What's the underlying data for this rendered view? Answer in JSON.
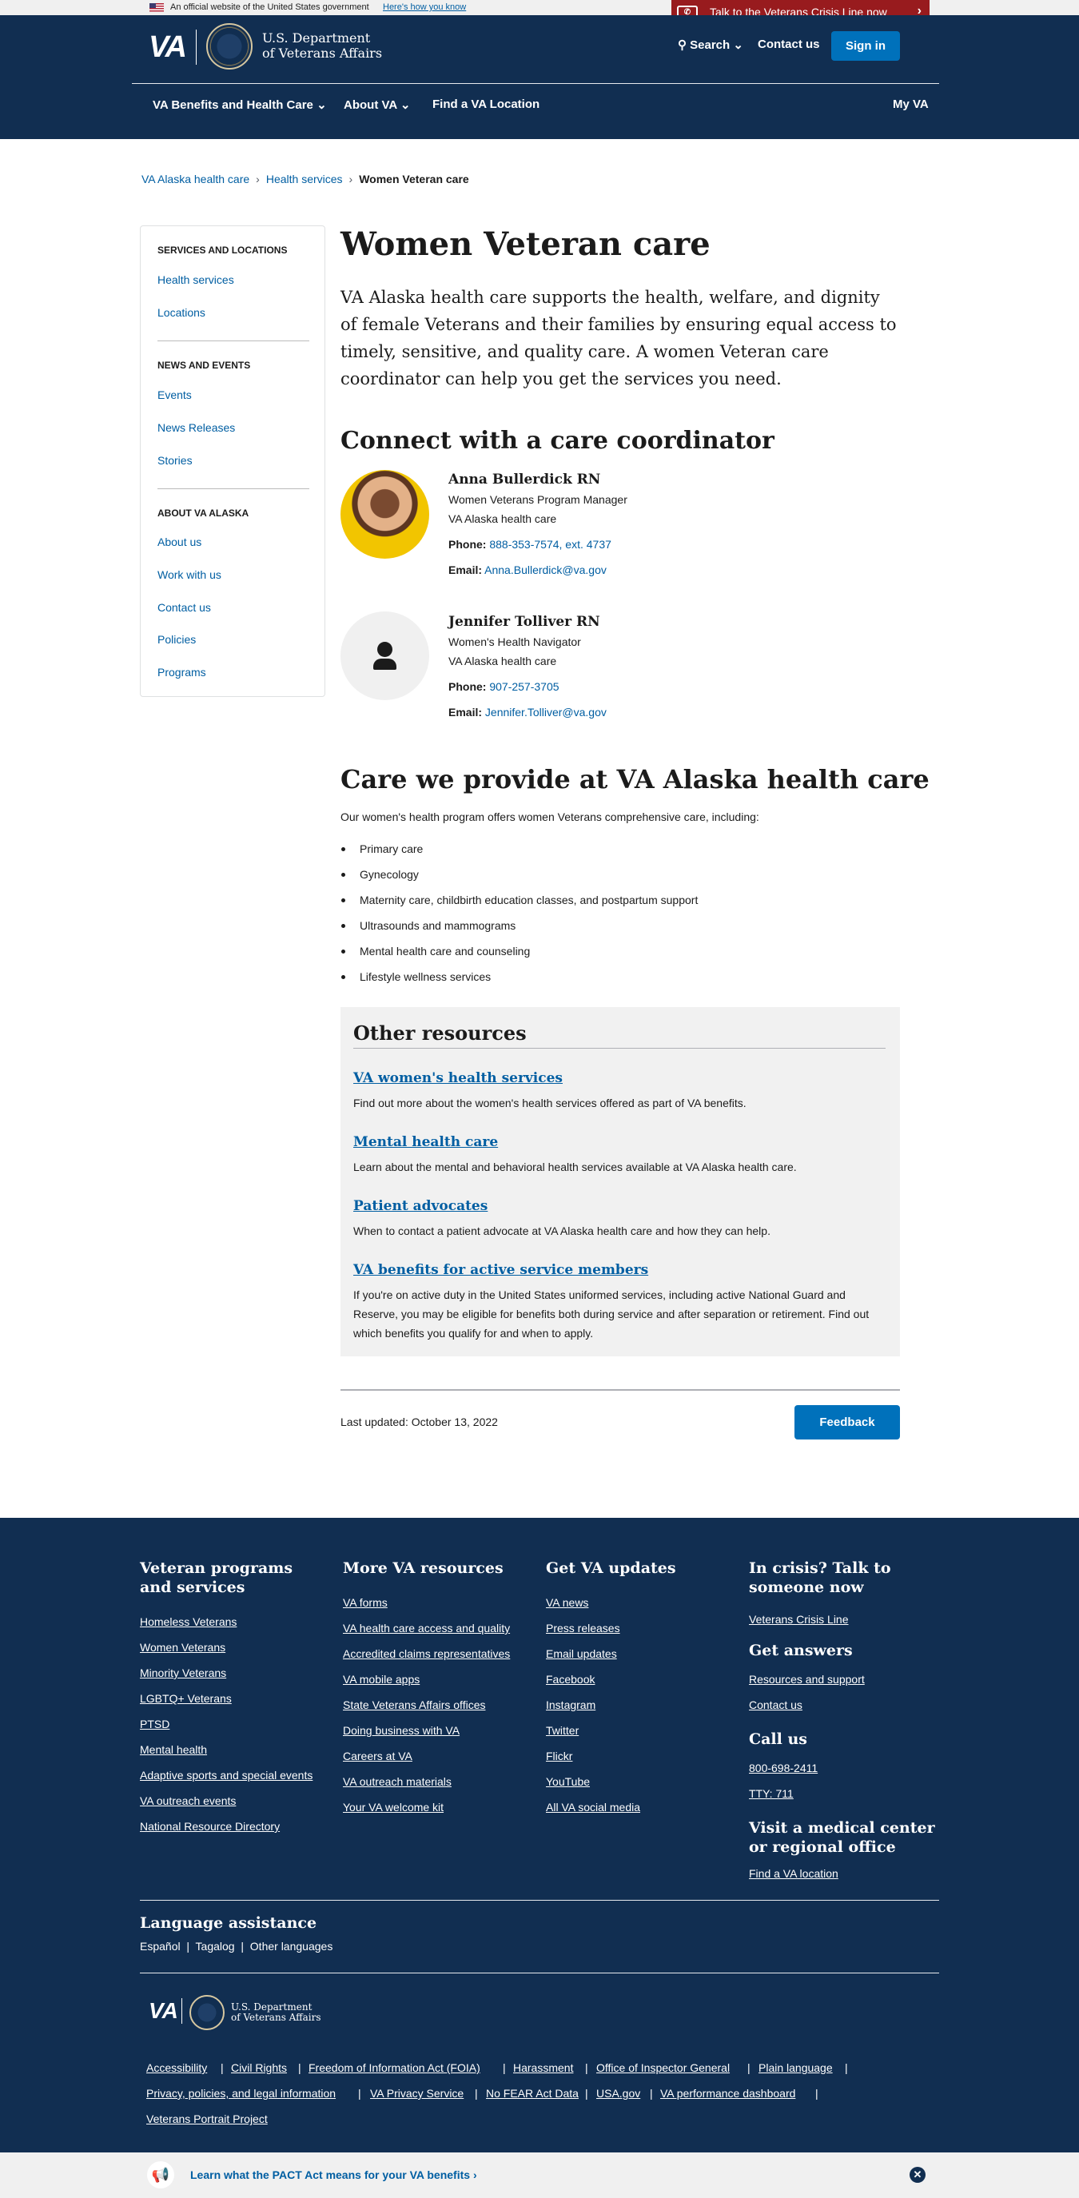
{
  "gov_banner": {
    "text": "An official website of the United States government",
    "how": "Here's how you know"
  },
  "crisis": {
    "text": "Talk to the Veterans Crisis Line now"
  },
  "header": {
    "logo": "VA",
    "dept_line1": "U.S. Department",
    "dept_line2": "of Veterans Affairs",
    "search": "Search",
    "contact": "Contact us",
    "signin": "Sign in",
    "nav": [
      "VA Benefits and Health Care",
      "About VA",
      "Find a VA Location",
      "My VA"
    ]
  },
  "breadcrumb": [
    "VA Alaska health care",
    "Health services",
    "Women Veteran care"
  ],
  "sidebar": {
    "sections": [
      {
        "heading": "SERVICES AND LOCATIONS",
        "links": [
          "Health services",
          "Locations"
        ]
      },
      {
        "heading": "NEWS AND EVENTS",
        "links": [
          "Events",
          "News Releases",
          "Stories"
        ]
      },
      {
        "heading": "ABOUT VA ALASKA",
        "links": [
          "About us",
          "Work with us",
          "Contact us",
          "Policies",
          "Programs"
        ]
      }
    ]
  },
  "main": {
    "title": "Women Veteran care",
    "intro": "VA Alaska health care supports the health, welfare, and dignity of female Veterans and their families by ensuring equal access to timely, sensitive, and quality care. A women Veteran care coordinator can help you get the services you need.",
    "connect_heading": "Connect with a care coordinator",
    "phone_label": "Phone:",
    "email_label": "Email:",
    "people": [
      {
        "name": "Anna Bullerdick RN",
        "role": "Women Veterans Program Manager",
        "org": "VA Alaska health care",
        "phone": "888-353-7574, ext. 4737",
        "email": "Anna.Bullerdick@va.gov"
      },
      {
        "name": "Jennifer Tolliver RN",
        "role": "Women's Health Navigator",
        "org": "VA Alaska health care",
        "phone": "907-257-3705",
        "email": "Jennifer.Tolliver@va.gov"
      }
    ],
    "care_heading": "Care we provide at VA Alaska health care",
    "care_intro": "Our women's health program offers women Veterans comprehensive care, including:",
    "care_list": [
      "Primary care",
      "Gynecology",
      "Maternity care, childbirth education classes, and postpartum support",
      "Ultrasounds and mammograms",
      "Mental health care and counseling",
      "Lifestyle wellness services"
    ],
    "resources": {
      "heading": "Other resources",
      "items": [
        {
          "link": "VA women's health services",
          "desc": "Find out more about the women's health services offered as part of VA benefits."
        },
        {
          "link": "Mental health care",
          "desc": "Learn about the mental and behavioral health services available at VA Alaska health care."
        },
        {
          "link": "Patient advocates",
          "desc": "When to contact a patient advocate at VA Alaska health care and how they can help."
        },
        {
          "link": "VA benefits for active service members",
          "desc": "If you're on active duty in the United States uniformed services, including active National Guard and Reserve, you may be eligible for benefits both during service and after separation or retirement. Find out which benefits you qualify for and when to apply."
        }
      ]
    },
    "last_updated": "Last updated: October 13, 2022",
    "feedback": "Feedback"
  },
  "footer": {
    "col1": {
      "heading": "Veteran programs and services",
      "links": [
        "Homeless Veterans",
        "Women Veterans",
        "Minority Veterans",
        "LGBTQ+ Veterans",
        "PTSD",
        "Mental health",
        "Adaptive sports and special events",
        "VA outreach events",
        "National Resource Directory"
      ]
    },
    "col2": {
      "heading": "More VA resources",
      "links": [
        "VA forms",
        "VA health care access and quality",
        "Accredited claims representatives",
        "VA mobile apps",
        "State Veterans Affairs offices",
        "Doing business with VA",
        "Careers at VA",
        "VA outreach materials",
        "Your VA welcome kit"
      ]
    },
    "col3": {
      "heading": "Get VA updates",
      "links": [
        "VA news",
        "Press releases",
        "Email updates",
        "Facebook",
        "Instagram",
        "Twitter",
        "Flickr",
        "YouTube",
        "All VA social media"
      ]
    },
    "col4": {
      "crisis_heading": "In crisis? Talk to someone now",
      "crisis_link": "Veterans Crisis Line",
      "answers_heading": "Get answers",
      "answers_links": [
        "Resources and support",
        "Contact us"
      ],
      "call_heading": "Call us",
      "call_links": [
        "800-698-2411",
        "TTY: 711"
      ],
      "visit_heading": "Visit a medical center or regional office",
      "visit_link": "Find a VA location"
    },
    "language": {
      "heading": "Language assistance",
      "links": [
        "Español",
        "Tagalog",
        "Other languages"
      ]
    },
    "logo": "VA",
    "dept_line1": "U.S. Department",
    "dept_line2": "of Veterans Affairs",
    "bottom_links": [
      "Accessibility",
      "Civil Rights",
      "Freedom of Information Act (FOIA)",
      "Harassment",
      "Office of Inspector General",
      "Plain language",
      "Privacy, policies, and legal information",
      "VA Privacy Service",
      "No FEAR Act Data",
      "USA.gov",
      "VA performance dashboard",
      "Veterans Portrait Project"
    ]
  },
  "pact": {
    "text": "Learn what the PACT Act means for your VA benefits ›"
  }
}
